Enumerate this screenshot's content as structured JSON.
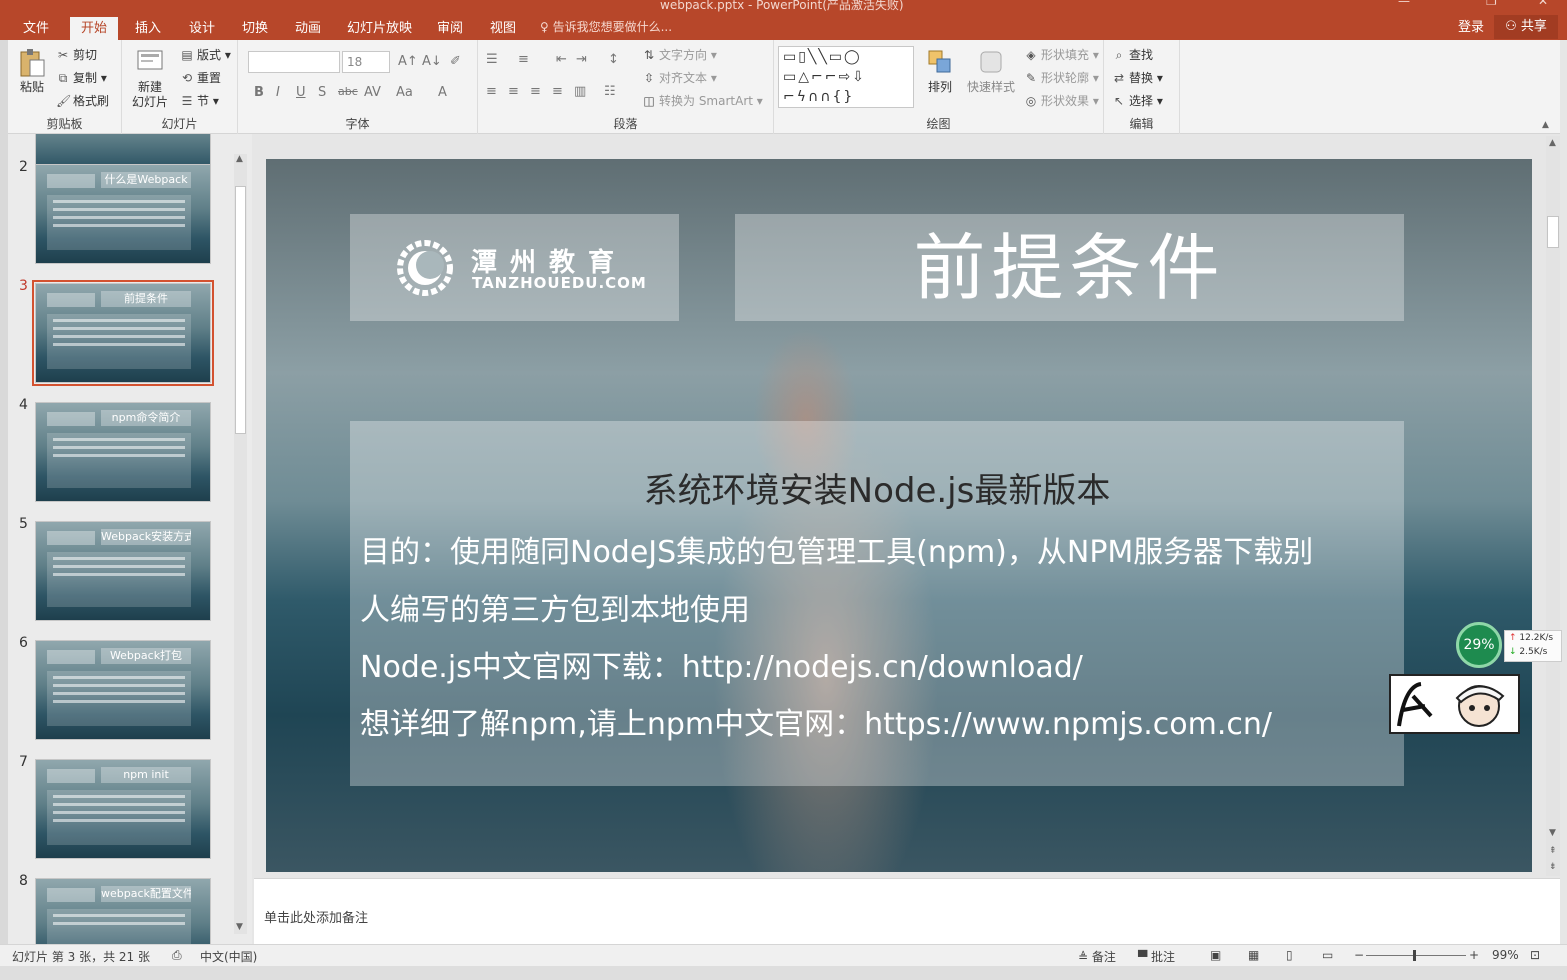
{
  "window": {
    "title": "webpack.pptx - PowerPoint(产品激活失败)"
  },
  "tabs": [
    {
      "label": "文件"
    },
    {
      "label": "开始"
    },
    {
      "label": "插入"
    },
    {
      "label": "设计"
    },
    {
      "label": "切换"
    },
    {
      "label": "动画"
    },
    {
      "label": "幻灯片放映"
    },
    {
      "label": "审阅"
    },
    {
      "label": "视图"
    }
  ],
  "tell_me": "告诉我您想要做什么...",
  "login": "登录",
  "share": "共享",
  "ribbon": {
    "clipboard": {
      "paste": "粘贴",
      "cut": "剪切",
      "copy": "复制",
      "format_painter": "格式刷",
      "label": "剪贴板"
    },
    "slides": {
      "new_slide": "新建\n幻灯片",
      "layout": "版式",
      "reset": "重置",
      "section": "节",
      "label": "幻灯片"
    },
    "font": {
      "size": "18",
      "label": "字体"
    },
    "paragraph": {
      "text_direction": "文字方向",
      "align_text": "对齐文本",
      "smartart": "转换为 SmartArt",
      "label": "段落"
    },
    "drawing": {
      "arrange": "排列",
      "quick_styles": "快速样式",
      "shape_fill": "形状填充",
      "shape_outline": "形状轮廓",
      "shape_effects": "形状效果",
      "label": "绘图"
    },
    "editing": {
      "find": "查找",
      "replace": "替换",
      "select": "选择",
      "label": "编辑"
    }
  },
  "thumbnails": [
    {
      "num": "2",
      "title": "什么是Webpack"
    },
    {
      "num": "3",
      "title": "前提条件"
    },
    {
      "num": "4",
      "title": "npm命令简介"
    },
    {
      "num": "5",
      "title": "Webpack安装方式"
    },
    {
      "num": "6",
      "title": "Webpack打包"
    },
    {
      "num": "7",
      "title": "npm init"
    },
    {
      "num": "8",
      "title": "webpack配置文件"
    }
  ],
  "slide": {
    "logo_cn": "潭州教育",
    "logo_en": "TANZHOUEDU.COM",
    "title": "前提条件",
    "heading": "系统环境安装Node.js最新版本",
    "lines": [
      "目的：使用随同NodeJS集成的包管理工具(npm)，从NPM服务器下载别",
      "人编写的第三方包到本地使用",
      "Node.js中文官网下载：http://nodejs.cn/download/",
      "想详细了解npm,请上npm中文官网：https://www.npmjs.com.cn/"
    ]
  },
  "net_monitor": {
    "percent": "29%",
    "up": "12.2K/s",
    "down": "2.5K/s"
  },
  "notes_placeholder": "单击此处添加备注",
  "status": {
    "slide_info": "幻灯片 第 3 张，共 21 张",
    "language": "中文(中国)",
    "notes": "备注",
    "comments": "批注",
    "zoom": "99%"
  },
  "colors": {
    "accent": "#b7472a",
    "selected_thumb": "#d35230"
  }
}
